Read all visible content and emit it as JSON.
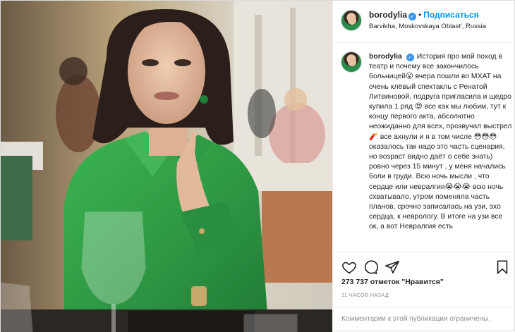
{
  "post": {
    "username": "borodylia",
    "verified": true,
    "separator": "•",
    "follow_label": "Подписаться",
    "location": "Barvikha, Moskovskaya Oblast', Russia",
    "caption": "История про мой поход в театр и почему все закончилось больницей😮 вчера пошли во МХАТ на очень клёвый спектакль с Ренатой Литвиновой, подруга пригласила и щедро купила 1 ряд 😍 все как мы любим, тут к концу первого акта, абсолютно неожиданно для всех, прозвучал выстрел🧨 все ахнули и я в том числе 😳😳😳 оказалось так надо это часть сценария, но возраст видно даёт о себе знать) ровно через 15 минут , у меня начались боли в груди. Всю ночь мысли , что сердце или невралгия😭😭😭 всю ночь схватывало, утром поменяла часть планов, срочно записалась на узи, эхо сердца, к неврологу. В итоге на узи все ок, а вот Невралгия есть",
    "likes_text": "273 737 отметок \"Нравится\"",
    "time_ago": "11 часов назад",
    "comments_disabled": "Комментарии к этой публикации ограничены."
  },
  "icons": {
    "like": "heart-icon",
    "comment": "comment-icon",
    "share": "paper-plane-icon",
    "save": "bookmark-icon"
  },
  "colors": {
    "follow_blue": "#0095f6",
    "verified_blue": "#3897f0",
    "blouse_green": "#2f9a45",
    "muted_text": "#8e8e8e"
  }
}
